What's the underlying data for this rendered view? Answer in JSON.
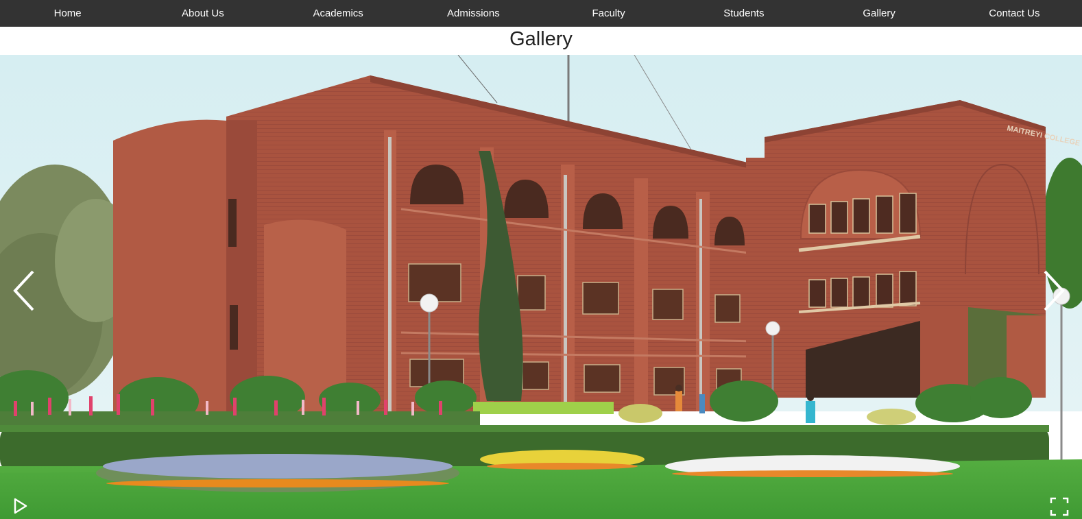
{
  "nav": {
    "items": [
      {
        "label": "Home"
      },
      {
        "label": "About Us"
      },
      {
        "label": "Academics"
      },
      {
        "label": "Admissions"
      },
      {
        "label": "Faculty"
      },
      {
        "label": "Students"
      },
      {
        "label": "Gallery"
      },
      {
        "label": "Contact Us"
      }
    ]
  },
  "page": {
    "title": "Gallery"
  },
  "slideshow": {
    "image_sign_text": "MAITREYI COLLEGE",
    "controls": {
      "prev_icon": "chevron-left-icon",
      "next_icon": "chevron-right-icon",
      "play_icon": "play-icon",
      "fullscreen_icon": "fullscreen-icon"
    }
  },
  "colors": {
    "navbar_bg": "#333333",
    "nav_text": "#ffffff",
    "title_text": "#222222",
    "sky": "#d3ecf1",
    "brick": "#a5503f",
    "lawn": "#49a43c"
  }
}
